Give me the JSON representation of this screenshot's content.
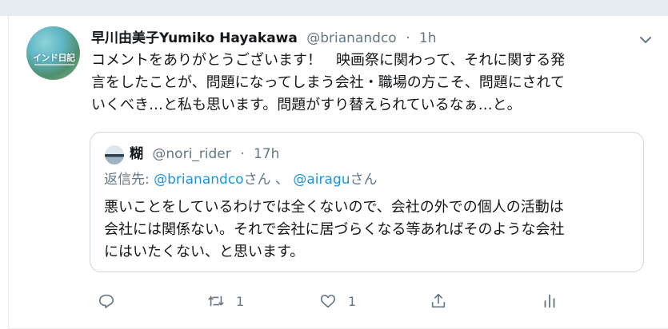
{
  "tweet": {
    "avatar_text": "インド日記",
    "display_name": "早川由美子Yumiko Hayakawa",
    "handle": "@brianandco",
    "separator": "·",
    "time": "1h",
    "body_lines": [
      "コメントをありがとうございます！　映画祭に関わって、それに関する発",
      "言をしたことが、問題になってしまう会社・職場の方こそ、問題にされて",
      "いくべき…と私も思います。問題がすり替えられているなぁ…と。"
    ]
  },
  "quoted": {
    "display_name": "糊",
    "handle": "@nori_rider",
    "separator": "·",
    "time": "17h",
    "reply_prefix": "返信先: ",
    "reply_user1": "@brianandco",
    "reply_san1": "さん",
    "reply_sep": " 、 ",
    "reply_user2": "@airagu",
    "reply_san2": "さん",
    "body_lines": [
      "悪いことをしているわけでは全くないので、会社の外での個人の活動は",
      "会社には関係ない。それで会社に居づらくなる等あればそのような会社",
      "にはいたくない、と思います。"
    ]
  },
  "actions": {
    "reply_count": "",
    "retweet_count": "1",
    "like_count": "1"
  },
  "colors": {
    "link": "#1b95e0",
    "secondary": "#657786",
    "border": "#ccd6dd",
    "page_bg": "#e6ecf0"
  },
  "icons": [
    "chevron-down-icon",
    "reply-icon",
    "retweet-icon",
    "like-icon",
    "share-icon",
    "analytics-icon"
  ]
}
